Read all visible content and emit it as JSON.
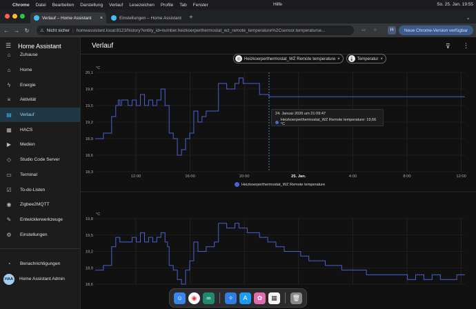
{
  "menubar": {
    "apple_icon": "apple-icon",
    "app": "Chrome",
    "items": [
      "Datei",
      "Bearbeiten",
      "Darstellung",
      "Verlauf",
      "Lesezeichen",
      "Profile",
      "Tab",
      "Fenster"
    ],
    "center": "Hilfe",
    "datetime": "So. 25. Jan.  19:55"
  },
  "tabs": [
    {
      "title": "Verlauf – Home Assistant",
      "active": true
    },
    {
      "title": "Einstellungen – Home Assistant",
      "active": false
    }
  ],
  "toolbar": {
    "not_secure": "Nicht sicher",
    "url": "homeassistant.local:8123/history?entity_id=number.heizkoerperthermostat_wz_remote_temperature%2Csensor.temperaturse...",
    "update_label": "Neue Chrome-Version verfügbar",
    "ext_h": "H"
  },
  "sidebar": {
    "title": "Home Assistant",
    "items": [
      {
        "label": "Zuhause",
        "icon": "home-icon"
      },
      {
        "label": "Home",
        "icon": "home-icon"
      },
      {
        "label": "Energie",
        "icon": "lightning-icon"
      },
      {
        "label": "Aktivität",
        "icon": "list-icon"
      },
      {
        "label": "Verlauf",
        "icon": "chart-icon"
      },
      {
        "label": "HACS",
        "icon": "hacs-icon"
      },
      {
        "label": "Medien",
        "icon": "media-icon"
      },
      {
        "label": "Studio Code Server",
        "icon": "code-icon"
      },
      {
        "label": "Terminal",
        "icon": "terminal-icon"
      },
      {
        "label": "To-do-Listen",
        "icon": "todo-icon"
      },
      {
        "label": "Zigbee2MQTT",
        "icon": "zigbee-icon"
      },
      {
        "label": "Entwicklerwerkzeuge",
        "icon": "wrench-icon"
      },
      {
        "label": "Einstellungen",
        "icon": "gear-icon"
      }
    ],
    "notifications": "Benachrichtigungen",
    "user": "Home Assistant Admin",
    "user_initials": "HAA"
  },
  "main": {
    "title": "Verlauf"
  },
  "chips": [
    {
      "label": "Heizkoerperthermostat_WZ Remote temperature",
      "icon": "thermostat-icon"
    },
    {
      "label": "Temperatur",
      "icon": "thermometer-icon"
    }
  ],
  "tooltip": {
    "time": "24. Januar 2026 um 21:09:47",
    "entry": "Heizkoerperthermostat_WZ Remote temperature: 19,66 °C"
  },
  "legend1": "Heizkoerperthermostat_WZ Remote temperature",
  "colors": {
    "series": "#4b61d1",
    "accent": "#41bdf5"
  },
  "chart_data": [
    {
      "type": "line",
      "ylabel": "°C",
      "ylim": [
        18.3,
        20.1
      ],
      "yticks": [
        "20,1",
        "19,8",
        "19,5",
        "19,2",
        "18,9",
        "18,6",
        "18,3"
      ],
      "xtick_labels": [
        "12:00",
        "16:00",
        "20:00",
        "25. Jan.",
        "4:00",
        "8:00",
        "12:00"
      ],
      "series": [
        {
          "name": "Heizkoerperthermostat_WZ Remote temperature",
          "x": [
            0,
            0.5,
            1,
            1.5,
            2,
            2.5,
            2.8,
            3,
            3.2,
            3.5,
            4,
            4.5,
            5,
            5.5,
            6,
            6.5,
            7,
            7.5,
            8,
            8.5,
            8.8,
            9,
            9.5,
            10,
            10.5,
            11,
            11.5,
            12,
            12.5,
            13,
            13.5,
            14,
            14.5,
            15,
            15.5,
            16,
            16.5,
            17,
            17.5,
            18,
            18.5,
            19,
            19.5,
            20,
            20.5,
            21,
            21.16,
            21.5,
            45
          ],
          "y": [
            18.9,
            18.9,
            19.0,
            19.0,
            19.3,
            19.5,
            19.6,
            19.5,
            19.6,
            19.6,
            19.5,
            19.6,
            19.5,
            19.7,
            19.5,
            19.6,
            19.5,
            19.6,
            19.8,
            19.5,
            19.5,
            19.0,
            18.9,
            18.6,
            18.7,
            18.9,
            19.0,
            19.4,
            19.2,
            19.3,
            19.4,
            19.4,
            19.4,
            19.9,
            19.9,
            19.8,
            19.8,
            19.9,
            20.0,
            19.9,
            19.9,
            19.9,
            19.9,
            19.7,
            19.7,
            19.7,
            19.66,
            19.66,
            19.66
          ]
        }
      ]
    },
    {
      "type": "line",
      "ylabel": "°C",
      "ylim": [
        18.6,
        20.0
      ],
      "yticks": [
        "19,8",
        "19,5",
        "19,2",
        "18,9",
        "18,6"
      ],
      "series": [
        {
          "name": "Temperatur",
          "x": [
            0,
            0.5,
            1,
            1.5,
            2,
            2.5,
            2.8,
            3,
            3.5,
            4,
            4.5,
            5,
            5.5,
            6,
            6.5,
            7,
            7.5,
            8,
            8.5,
            8.8,
            9,
            9.5,
            10,
            10.5,
            11,
            11.5,
            12,
            12.5,
            13,
            13.5,
            14,
            14.5,
            15,
            15.5,
            16,
            16.5,
            17,
            17.5,
            18,
            18.5,
            19,
            19.5,
            20,
            20.5,
            21,
            22,
            23,
            24,
            25,
            26,
            27,
            28,
            29,
            30,
            31,
            32,
            33,
            34,
            35,
            36,
            37,
            38,
            39,
            40,
            41,
            42,
            43,
            44,
            45
          ],
          "y": [
            18.9,
            18.9,
            19.0,
            19.0,
            19.4,
            19.6,
            19.6,
            19.5,
            19.5,
            19.5,
            19.6,
            19.5,
            19.7,
            19.5,
            19.6,
            19.5,
            19.6,
            19.7,
            19.5,
            19.4,
            19.0,
            18.9,
            18.7,
            18.6,
            18.9,
            19.1,
            19.5,
            19.3,
            19.3,
            19.4,
            19.4,
            19.5,
            19.9,
            19.9,
            19.8,
            19.8,
            19.9,
            19.8,
            19.8,
            19.7,
            19.7,
            19.7,
            19.6,
            19.6,
            19.5,
            19.4,
            19.3,
            19.3,
            19.2,
            19.1,
            19.1,
            19.0,
            19.0,
            18.9,
            18.9,
            18.9,
            18.8,
            18.8,
            18.8,
            18.8,
            18.8,
            18.7,
            18.8,
            18.7,
            18.8,
            18.7,
            18.7,
            18.8,
            18.8
          ]
        }
      ]
    }
  ],
  "dock": [
    "finder-icon",
    "chrome-icon",
    "copilot-icon",
    "safari-icon",
    "app-store-icon",
    "photos-icon",
    "calendar-icon",
    "trash-icon"
  ]
}
